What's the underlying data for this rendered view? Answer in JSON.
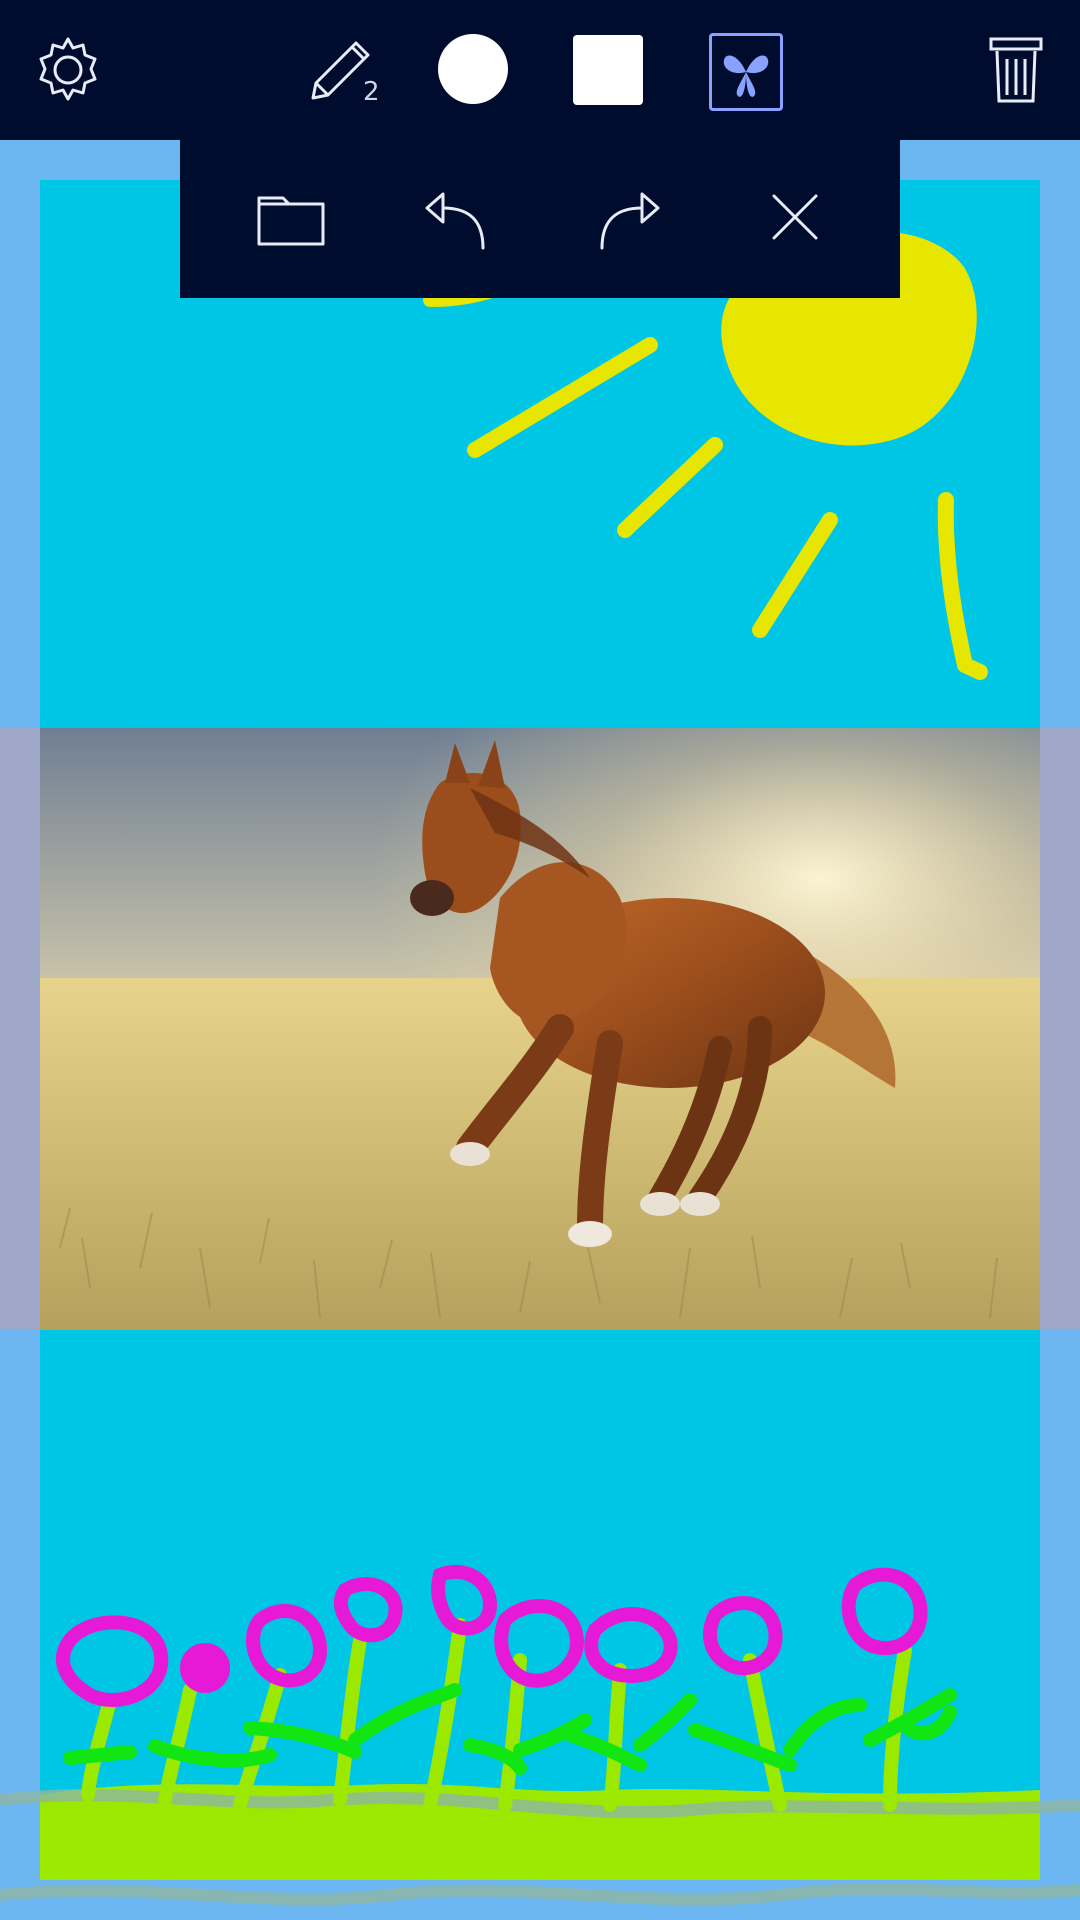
{
  "app": {
    "colors": {
      "toolbar_bg": "#000c2e",
      "canvas_bg": "#00c6e6",
      "frame": "#6cb6f2",
      "sun": "#e6e600",
      "flower_pink": "#e61ad6",
      "grass_green": "#9be800",
      "leaf_green": "#12e612",
      "accent": "#8aa2ff"
    }
  },
  "toolbar": {
    "settings_icon": "gear-icon",
    "pencil_icon": "pencil-icon",
    "pencil_size": "2",
    "brush_color_icon": "circle-color-icon",
    "shape_icon": "square-icon",
    "sticker_icon": "butterfly-sticker-icon",
    "trash_icon": "trash-icon"
  },
  "dropdown": {
    "folder_icon": "folder-icon",
    "undo_icon": "undo-icon",
    "redo_icon": "redo-icon",
    "close_icon": "close-icon"
  },
  "canvas": {
    "photo_subject": "horse-photo"
  }
}
